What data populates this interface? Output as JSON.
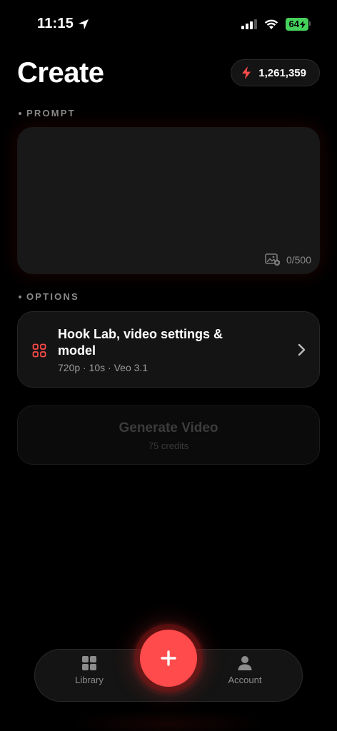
{
  "status_bar": {
    "time": "11:15",
    "battery": "64"
  },
  "header": {
    "title": "Create",
    "credits": "1,261,359"
  },
  "prompt": {
    "section_label": "PROMPT",
    "value": "",
    "placeholder": "",
    "char_count": "0/500"
  },
  "options": {
    "section_label": "OPTIONS",
    "title": "Hook Lab, video settings & model",
    "subtitle": "720p · 10s · Veo 3.1"
  },
  "generate": {
    "label": "Generate Video",
    "sublabel": "75 credits"
  },
  "nav": {
    "library_label": "Library",
    "account_label": "Account"
  },
  "colors": {
    "accent": "#ff4b4b",
    "battery": "#45d15b",
    "background": "#000000"
  },
  "icons": {
    "location": "location-arrow-icon",
    "signal": "cellular-signal-icon",
    "wifi": "wifi-icon",
    "credits": "lightning-bolt-icon",
    "image": "image-attach-icon",
    "options": "grid-icon",
    "chevron": "chevron-right-icon",
    "library": "library-grid-icon",
    "account": "person-icon",
    "fab": "plus-icon"
  }
}
